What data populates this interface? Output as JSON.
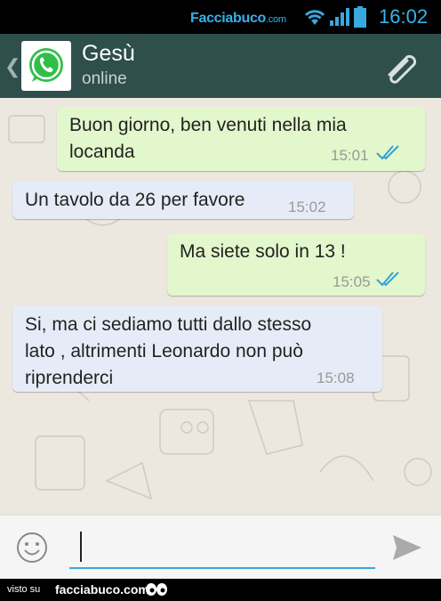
{
  "status_bar": {
    "watermark": "Facciabuco",
    "watermark_suffix": ".com",
    "time": "16:02",
    "icons": [
      "wifi-icon",
      "signal-icon",
      "battery-icon"
    ],
    "accent": "#37b0e6"
  },
  "header": {
    "contact_name": "Gesù",
    "status": "online",
    "icons": [
      "back-icon",
      "whatsapp-logo",
      "attach-icon"
    ],
    "background": "#2f4f4c"
  },
  "messages": [
    {
      "direction": "outgoing",
      "lines": [
        "Buon giorno, ben venuti nella mia",
        "locanda"
      ],
      "time": "15:01",
      "read": true
    },
    {
      "direction": "incoming",
      "lines": [
        "Un tavolo da 26 per favore"
      ],
      "time": "15:02"
    },
    {
      "direction": "outgoing",
      "lines": [
        "Ma siete solo in 13 !"
      ],
      "time": "15:05",
      "read": true
    },
    {
      "direction": "incoming",
      "lines": [
        "Si, ma ci sediamo tutti dallo stesso",
        "lato , altrimenti Leonardo non può",
        "riprenderci"
      ],
      "time": "15:08"
    }
  ],
  "composer": {
    "value": "",
    "icons": [
      "emoji-icon",
      "send-icon"
    ],
    "accent": "#3aa7dd"
  },
  "footer": {
    "visto_label": "visto su",
    "brand": "facciabuco.com"
  },
  "colors": {
    "outgoing_bubble": "#e2f7cb",
    "incoming_bubble": "#e6ecf7",
    "chat_background": "#ece8df",
    "read_ticks": "#34a0d8"
  }
}
